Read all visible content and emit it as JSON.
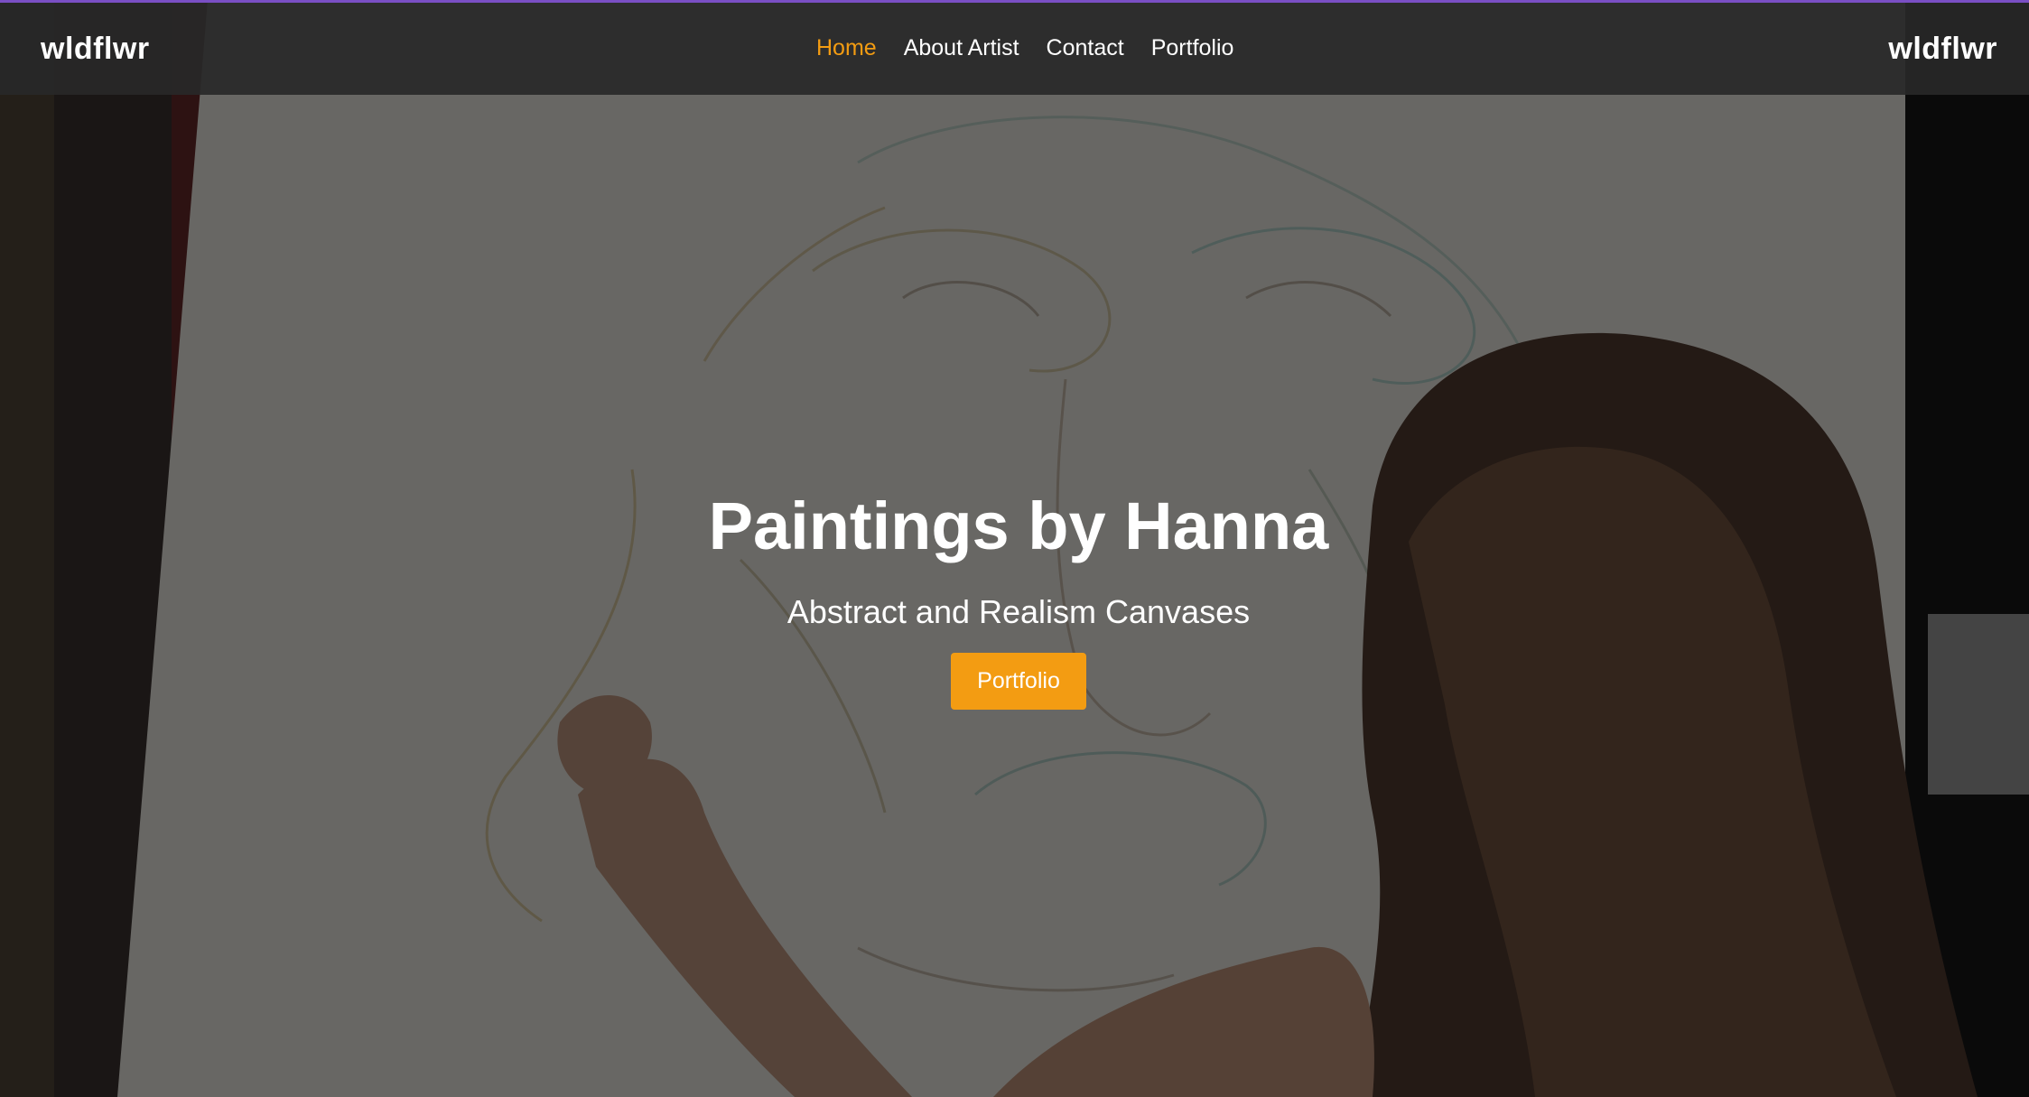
{
  "header": {
    "brand_left": "wldflwr",
    "brand_right": "wldflwr",
    "nav": [
      {
        "label": "Home",
        "active": true
      },
      {
        "label": "About Artist",
        "active": false
      },
      {
        "label": "Contact",
        "active": false
      },
      {
        "label": "Portfolio",
        "active": false
      }
    ]
  },
  "hero": {
    "title": "Paintings by Hanna",
    "subtitle": "Abstract and Realism Canvases",
    "button_label": "Portfolio"
  },
  "colors": {
    "accent": "#f39c12",
    "navbar": "#282828",
    "top_border": "#7a4fc4",
    "text": "#ffffff"
  }
}
